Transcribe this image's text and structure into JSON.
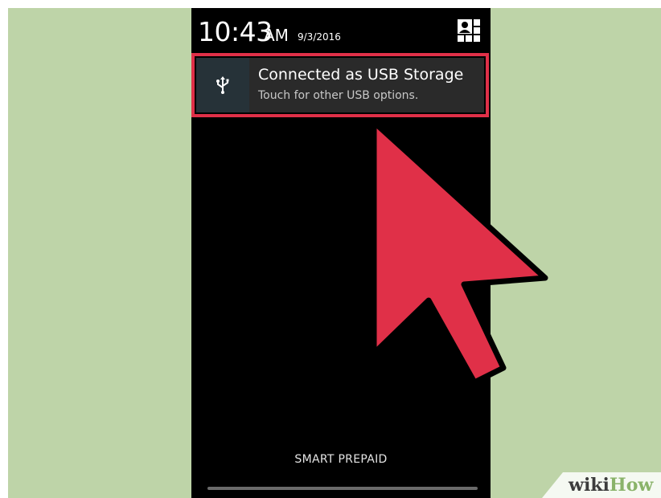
{
  "status_bar": {
    "time": "10:43",
    "ampm": "AM",
    "date": "9/3/2016",
    "settings_icon": "quick-settings-icon"
  },
  "notification": {
    "icon": "usb-icon",
    "title": "Connected as USB Storage",
    "subtitle": "Touch for other USB options.",
    "highlight_color": "#e03048"
  },
  "carrier_label": "SMART PREPAID",
  "pointer": {
    "icon": "pointer-arrow-icon",
    "color": "#e03048"
  },
  "watermark": {
    "wiki": "wiki",
    "how": "How"
  },
  "colors": {
    "background": "#bed4a8",
    "phone_screen": "#000000",
    "notification_card": "#2a2a2a",
    "notification_icon_tile": "#263238",
    "accent_red": "#e03048"
  }
}
